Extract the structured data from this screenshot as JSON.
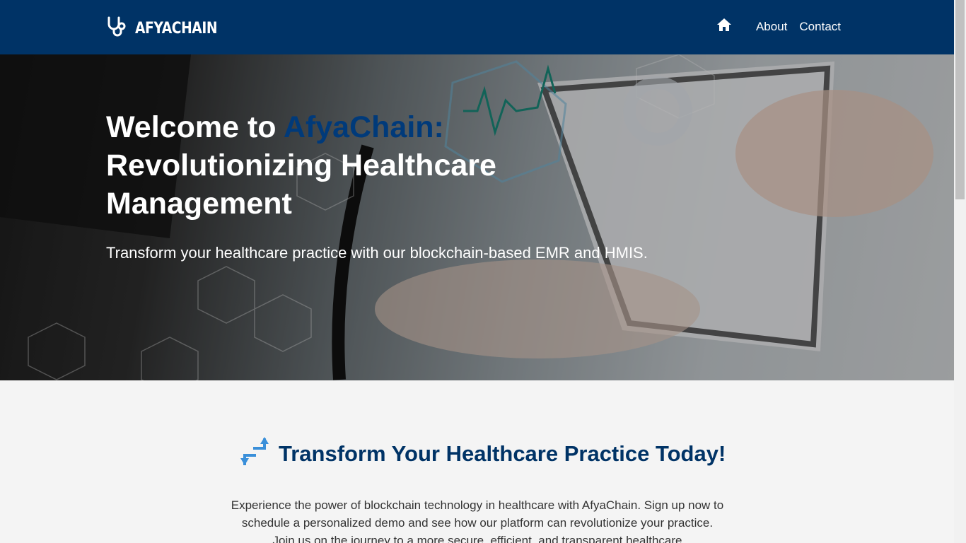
{
  "brand": {
    "name": "AFYACHAIN",
    "logo_icon": "stethoscope-icon"
  },
  "nav": {
    "home_icon": "home-icon",
    "about": "About",
    "contact": "Contact"
  },
  "hero": {
    "title_part1": "Welcome to ",
    "title_accent": "AfyaChain:",
    "title_part2": "Revolutionizing Healthcare Management",
    "subtitle": "Transform your healthcare practice with our blockchain-based EMR and HMIS."
  },
  "cta": {
    "icon": "exchange-arrows-icon",
    "title": "Transform Your Healthcare Practice Today!",
    "text": "Experience the power of blockchain technology in healthcare with AfyaChain. Sign up now to schedule a personalized demo and see how our platform can revolutionize your practice. Join us on the journey to a more secure, efficient, and transparent healthcare"
  },
  "colors": {
    "nav_bg": "#003366",
    "accent": "#003a7a",
    "cta_title": "#003366",
    "cta_icon": "#3a8fd9"
  }
}
